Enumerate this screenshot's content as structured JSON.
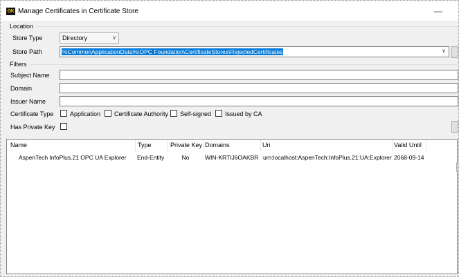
{
  "window": {
    "title": "Manage Certificates in Certificate Store",
    "icon_text": "GK",
    "minimize_glyph": "—"
  },
  "location": {
    "group_label": "Location",
    "store_type_label": "Store Type",
    "store_type_value": "Directory",
    "store_path_label": "Store Path",
    "store_path_value": "%CommonApplicationData%\\OPC Foundation\\CertificateStores\\RejectedCertificates"
  },
  "filters": {
    "group_label": "Filters",
    "subject_name_label": "Subject Name",
    "domain_label": "Domain",
    "issuer_name_label": "Issuer Name",
    "certificate_type_label": "Certificate Type",
    "type_options": [
      "Application",
      "Certificate Authority",
      "Self-signed",
      "Issued by CA"
    ],
    "has_private_key_label": "Has Private Key"
  },
  "table": {
    "columns": [
      "Name",
      "Type",
      "Private Key",
      "Domains",
      "Uri",
      "Valid Until"
    ],
    "rows": [
      {
        "name": "AspenTech InfoPlus.21 OPC UA Explorer",
        "type": "End-Entity",
        "private_key": "No",
        "domains": "WIN-KRTIJ6OAKBR",
        "uri": "urn:localhost:AspenTech:InfoPlus.21:UA:Explorer",
        "valid_until": "2068-09-14"
      }
    ]
  },
  "colors": {
    "selection": "#0078d7",
    "dialog_bg": "#f0f0f0",
    "icon_bg": "#111111",
    "icon_fg": "#f2c200"
  }
}
